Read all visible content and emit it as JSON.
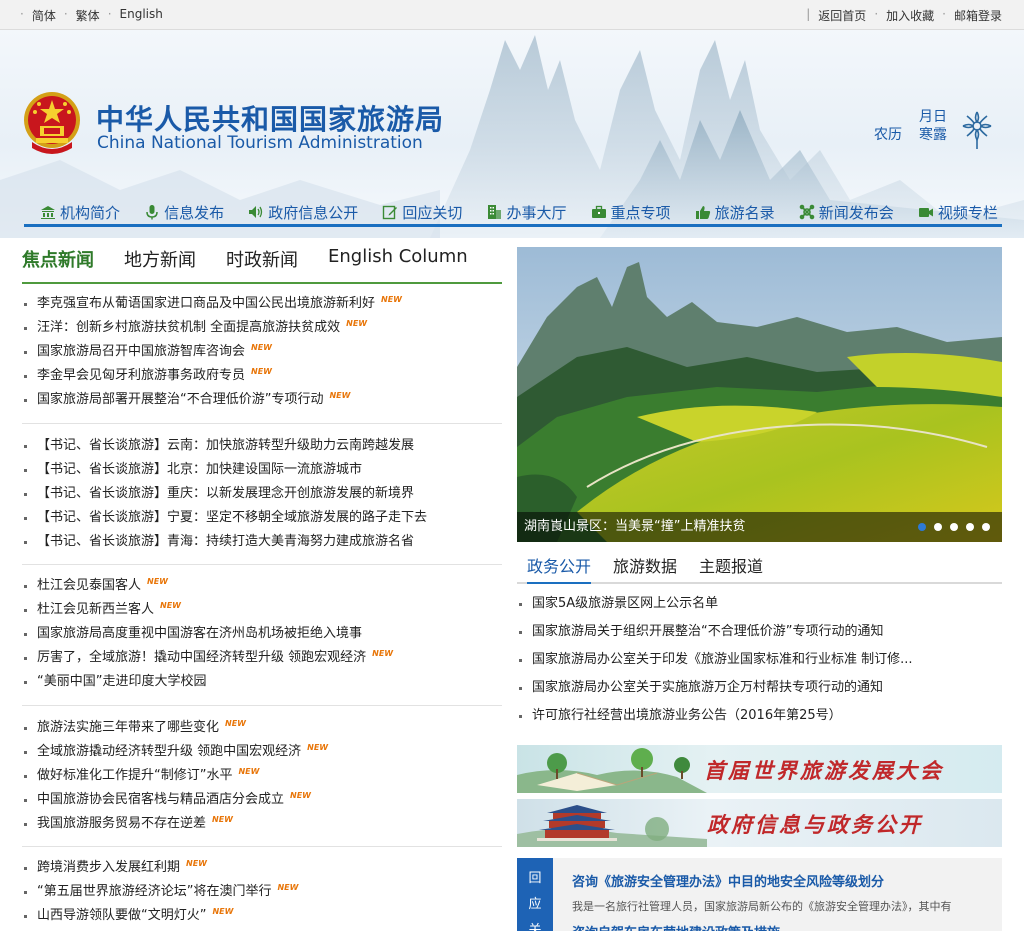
{
  "topbar": {
    "lang_simplified": "简体",
    "lang_traditional": "繁体",
    "lang_english": "English",
    "home": "返回首页",
    "favorite": "加入收藏",
    "mailbox": "邮箱登录"
  },
  "header": {
    "title_cn": "中华人民共和国国家旅游局",
    "title_en": "China National Tourism Administration",
    "cal_month_day": "月日",
    "cal_lunar": "农历",
    "cal_solar_term": "寒露"
  },
  "nav": [
    "机构简介",
    "信息发布",
    "政府信息公开",
    "回应关切",
    "办事大厅",
    "重点专项",
    "旅游名录",
    "新闻发布会",
    "视频专栏"
  ],
  "news_tabs": [
    "焦点新闻",
    "地方新闻",
    "时政新闻",
    "English Column"
  ],
  "new_badge": "NEW",
  "news_groups": [
    [
      {
        "t": "李克强宣布从葡语国家进口商品及中国公民出境旅游新利好",
        "n": true
      },
      {
        "t": "汪洋：创新乡村旅游扶贫机制 全面提高旅游扶贫成效",
        "n": true
      },
      {
        "t": "国家旅游局召开中国旅游智库咨询会",
        "n": true
      },
      {
        "t": "李金早会见匈牙利旅游事务政府专员",
        "n": true
      },
      {
        "t": "国家旅游局部署开展整治“不合理低价游”专项行动",
        "n": true
      }
    ],
    [
      {
        "t": "【书记、省长谈旅游】云南：加快旅游转型升级助力云南跨越发展",
        "n": false
      },
      {
        "t": "【书记、省长谈旅游】北京：加快建设国际一流旅游城市",
        "n": false
      },
      {
        "t": "【书记、省长谈旅游】重庆：以新发展理念开创旅游发展的新境界",
        "n": false
      },
      {
        "t": "【书记、省长谈旅游】宁夏：坚定不移朝全域旅游发展的路子走下去",
        "n": false
      },
      {
        "t": "【书记、省长谈旅游】青海：持续打造大美青海努力建成旅游名省",
        "n": false
      }
    ],
    [
      {
        "t": "杜江会见泰国客人",
        "n": true
      },
      {
        "t": "杜江会见新西兰客人",
        "n": true
      },
      {
        "t": "国家旅游局高度重视中国游客在济州岛机场被拒绝入境事",
        "n": false
      },
      {
        "t": "厉害了，全域旅游！撬动中国经济转型升级 领跑宏观经济",
        "n": true
      },
      {
        "t": "“美丽中国”走进印度大学校园",
        "n": false
      }
    ],
    [
      {
        "t": "旅游法实施三年带来了哪些变化",
        "n": true
      },
      {
        "t": "全域旅游撬动经济转型升级 领跑中国宏观经济",
        "n": true
      },
      {
        "t": "做好标准化工作提升“制修订”水平",
        "n": true
      },
      {
        "t": "中国旅游协会民宿客栈与精品酒店分会成立",
        "n": true
      },
      {
        "t": "我国旅游服务贸易不存在逆差",
        "n": true
      }
    ],
    [
      {
        "t": "跨境消费步入发展红利期",
        "n": true
      },
      {
        "t": "“第五届世界旅游经济论坛”将在澳门举行",
        "n": true
      },
      {
        "t": "山西导游领队要做“文明灯火”",
        "n": true
      }
    ]
  ],
  "slideshow": {
    "caption": "湖南崀山景区：当美景“撞”上精准扶贫",
    "slide_count": 5,
    "active_index": 0
  },
  "right_tabs": [
    "政务公开",
    "旅游数据",
    "主题报道"
  ],
  "gov_list": [
    "国家5A级旅游景区网上公示名单",
    "国家旅游局关于组织开展整治“不合理低价游”专项行动的通知",
    "国家旅游局办公室关于印发《旅游业国家标准和行业标准 制订修...",
    "国家旅游局办公室关于实施旅游万企万村帮扶专项行动的通知",
    "许可旅行社经营出境旅游业务公告（2016年第25号）"
  ],
  "ads": [
    "首届世界旅游发展大会",
    "政府信息与政务公开"
  ],
  "consult": {
    "side_label": "回应关",
    "title": "咨询《旅游安全管理办法》中目的地安全风险等级划分",
    "desc": "我是一名旅行社管理人员，国家旅游局新公布的《旅游安全管理办法》，其中有",
    "more": "咨询自驾车房车营地建设政策及措施"
  }
}
